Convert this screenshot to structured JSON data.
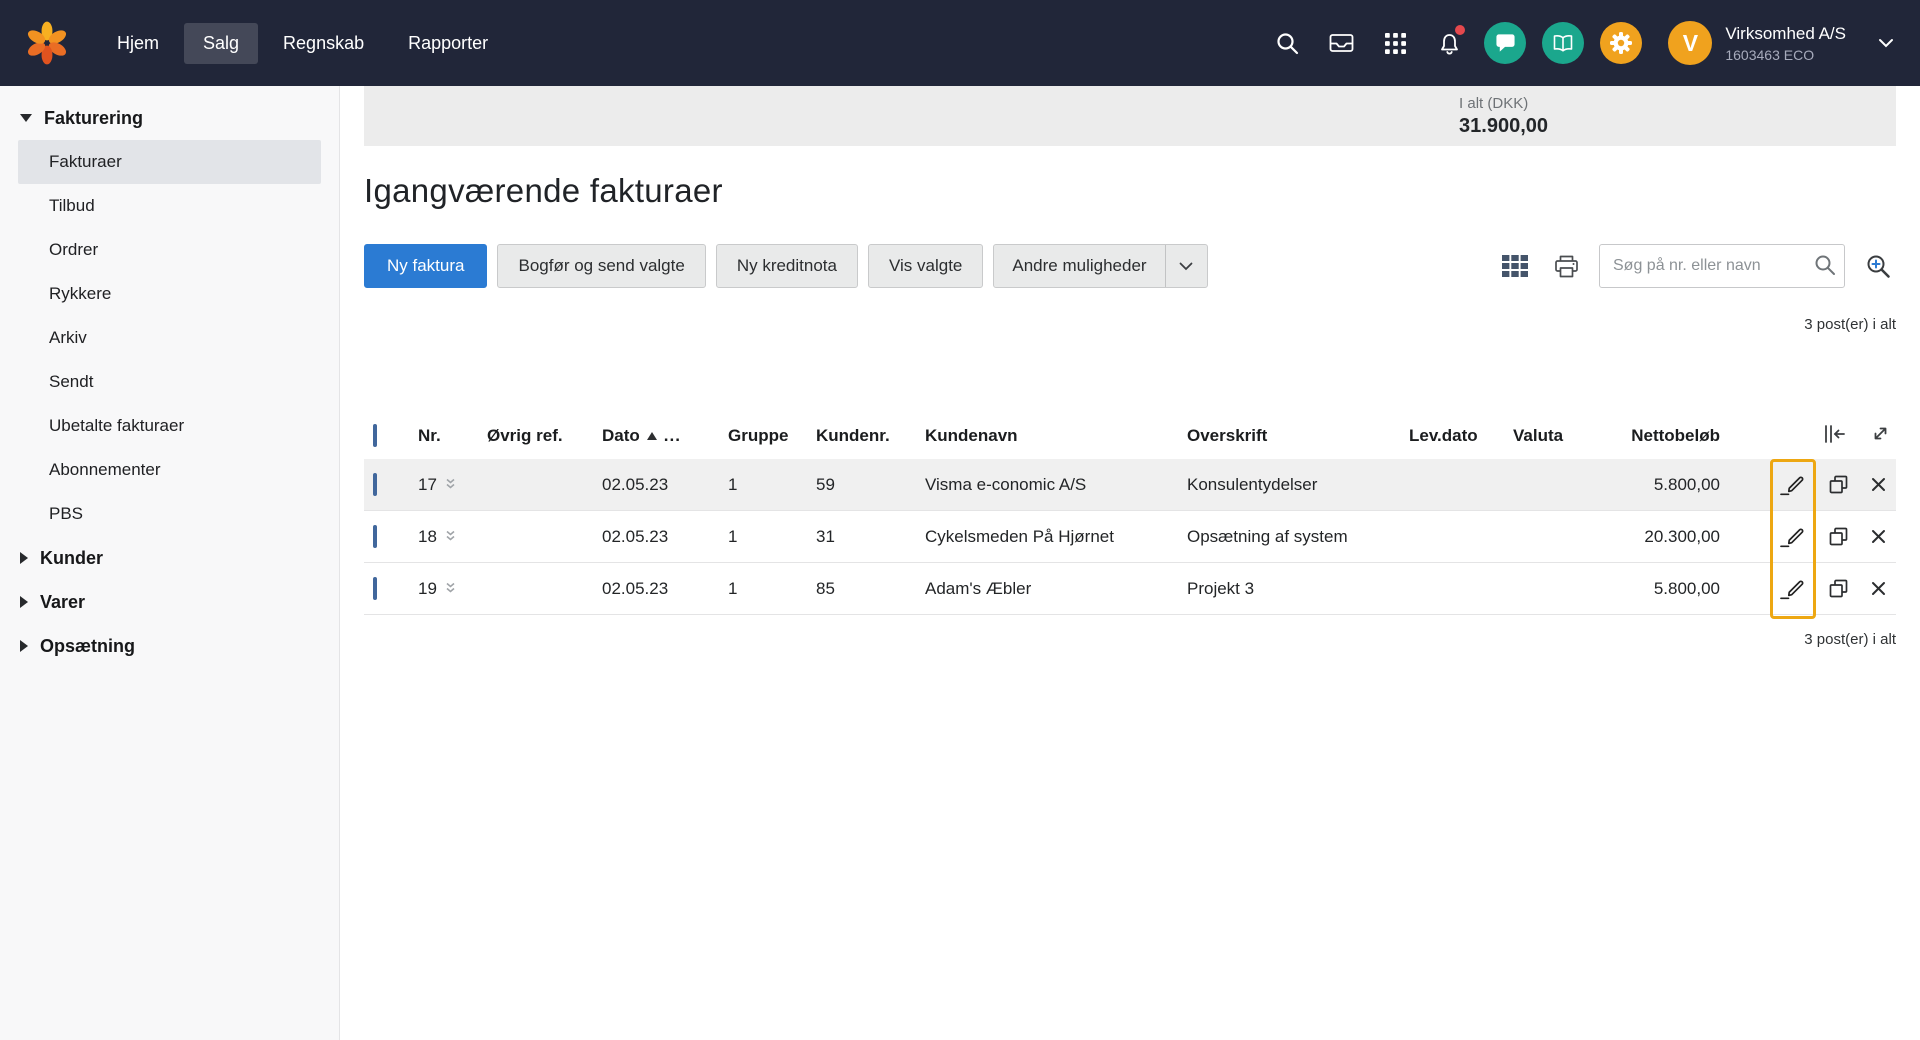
{
  "topbar": {
    "nav": [
      {
        "label": "Hjem",
        "active": false
      },
      {
        "label": "Salg",
        "active": true
      },
      {
        "label": "Regnskab",
        "active": false
      },
      {
        "label": "Rapporter",
        "active": false
      }
    ],
    "company_name": "Virksomhed A/S",
    "company_id": "1603463 ECO",
    "avatar_letter": "V"
  },
  "sidebar": {
    "sections": [
      {
        "label": "Fakturering",
        "expanded": true,
        "items": [
          {
            "label": "Fakturaer",
            "selected": true
          },
          {
            "label": "Tilbud",
            "selected": false
          },
          {
            "label": "Ordrer",
            "selected": false
          },
          {
            "label": "Rykkere",
            "selected": false
          },
          {
            "label": "Arkiv",
            "selected": false
          },
          {
            "label": "Sendt",
            "selected": false
          },
          {
            "label": "Ubetalte fakturaer",
            "selected": false
          },
          {
            "label": "Abonnementer",
            "selected": false
          },
          {
            "label": "PBS",
            "selected": false
          }
        ]
      },
      {
        "label": "Kunder",
        "expanded": false
      },
      {
        "label": "Varer",
        "expanded": false
      },
      {
        "label": "Opsætning",
        "expanded": false
      }
    ]
  },
  "summary": {
    "label": "I alt (DKK)",
    "value": "31.900,00"
  },
  "page_title": "Igangværende fakturaer",
  "toolbar": {
    "new_invoice": "Ny faktura",
    "post_and_send": "Bogfør og send valgte",
    "new_credit_note": "Ny kreditnota",
    "show_selected": "Vis valgte",
    "more_options": "Andre muligheder",
    "search_placeholder": "Søg på nr. eller navn"
  },
  "table": {
    "count_text": "3 post(er) i alt",
    "columns": {
      "nr": "Nr.",
      "ovrig_ref": "Øvrig ref.",
      "dato": "Dato",
      "dato_suffix": "...",
      "gruppe": "Gruppe",
      "kundenr": "Kundenr.",
      "kundenavn": "Kundenavn",
      "overskrift": "Overskrift",
      "lev_dato": "Lev.dato",
      "valuta": "Valuta",
      "nettobelob": "Nettobeløb"
    },
    "rows": [
      {
        "nr": "17",
        "ovrig_ref": "",
        "dato": "02.05.23",
        "gruppe": "1",
        "kundenr": "59",
        "kundenavn": "Visma e-conomic A/S",
        "overskrift": "Konsulentydelser",
        "lev_dato": "",
        "valuta": "",
        "nettobelob": "5.800,00"
      },
      {
        "nr": "18",
        "ovrig_ref": "",
        "dato": "02.05.23",
        "gruppe": "1",
        "kundenr": "31",
        "kundenavn": "Cykelsmeden På Hjørnet",
        "overskrift": "Opsætning af system",
        "lev_dato": "",
        "valuta": "",
        "nettobelob": "20.300,00"
      },
      {
        "nr": "19",
        "ovrig_ref": "",
        "dato": "02.05.23",
        "gruppe": "1",
        "kundenr": "85",
        "kundenavn": "Adam's Æbler",
        "overskrift": "Projekt 3",
        "lev_dato": "",
        "valuta": "",
        "nettobelob": "5.800,00"
      }
    ]
  },
  "colors": {
    "topbar_bg": "#212639",
    "primary_blue": "#2b7bd3",
    "accent_orange": "#f0a21e",
    "icon_green": "#1ba78d",
    "notification_red": "#e5484d",
    "annotation_highlight": "#eda712",
    "selected_row_bg": "#f0f0f0"
  }
}
